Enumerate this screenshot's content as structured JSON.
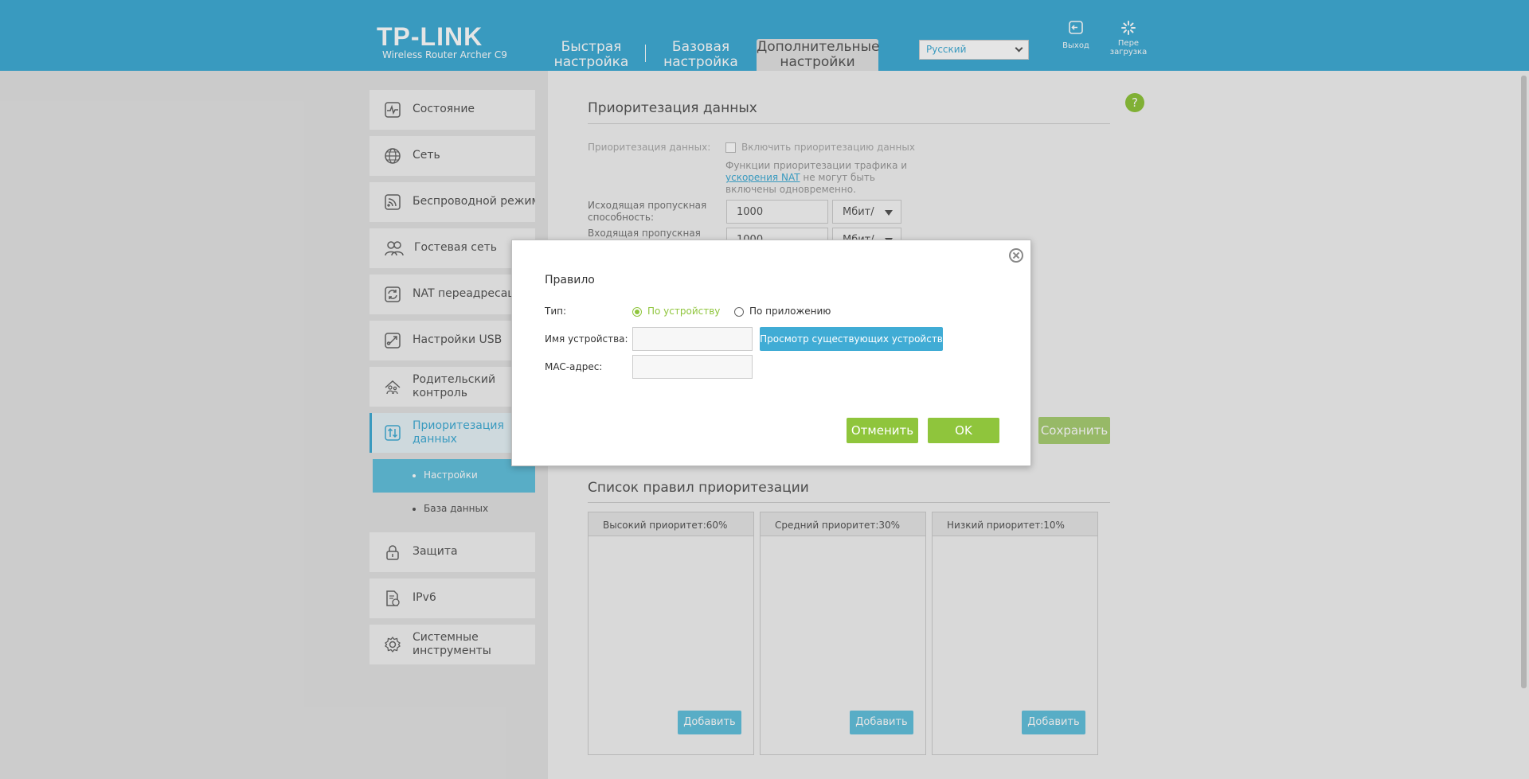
{
  "header": {
    "logo": "TP-LINK",
    "model": "Wireless Router Archer C9",
    "tabs": [
      {
        "line1": "Быстрая",
        "line2": "настройка"
      },
      {
        "line1": "Базовая",
        "line2": "настройка"
      },
      {
        "line1": "Дополнительные",
        "line2": "настройки"
      }
    ],
    "language": "Русский",
    "logout_label": "Выход",
    "reboot_line1": "Пере",
    "reboot_line2": "загрузка"
  },
  "sidebar": {
    "items": [
      {
        "label": "Состояние"
      },
      {
        "label": "Сеть"
      },
      {
        "label": "Беспроводной режим"
      },
      {
        "label": "Гостевая сеть"
      },
      {
        "label": "NAT переадресация"
      },
      {
        "label": "Настройки USB"
      },
      {
        "line1": "Родительский",
        "line2": "контроль"
      },
      {
        "line1": "Приоритезация",
        "line2": "данных"
      },
      {
        "label": "Защита"
      },
      {
        "label": "IPv6"
      },
      {
        "line1": "Системные",
        "line2": "инструменты"
      }
    ],
    "subitems": [
      {
        "label": "Настройки"
      },
      {
        "label": "База данных"
      }
    ]
  },
  "main": {
    "title": "Приоритезация данных",
    "prio_label": "Приоритезация данных:",
    "prio_checkbox_label": "Включить приоритезацию данных",
    "note_before": "Функции приоритезации трафика и",
    "note_link": "ускорения NAT",
    "note_after": " не могут быть включены одновременно.",
    "upload_label_line1": "Исходящая пропускная",
    "upload_label_line2": "способность:",
    "upload_value": "1000",
    "upload_unit": "Мбит/с",
    "download_label_line1": "Входящая пропускная",
    "download_value": "1000",
    "download_unit": "Мбит/с",
    "save_label": "Сохранить",
    "rules_title": "Список правил приоритезации",
    "priorities": [
      {
        "label": "Высокий приоритет:60%",
        "add": "Добавить"
      },
      {
        "label": "Средний приоритет:30%",
        "add": "Добавить"
      },
      {
        "label": "Низкий приоритет:10%",
        "add": "Добавить"
      }
    ]
  },
  "modal": {
    "title": "Правило",
    "type_label": "Тип:",
    "type_option_device": "По устройству",
    "type_option_app": "По приложению",
    "device_name_label": "Имя устройства:",
    "device_name_value": "",
    "browse_devices_label": "Просмотр существующих устройств",
    "mac_label": "MAC-адрес:",
    "mac_value": "",
    "cancel_label": "Отменить",
    "ok_label": "OK"
  },
  "colors": {
    "brand_blue": "#40acd5",
    "green": "#8fc53c",
    "light_blue": "#62c1dd"
  }
}
